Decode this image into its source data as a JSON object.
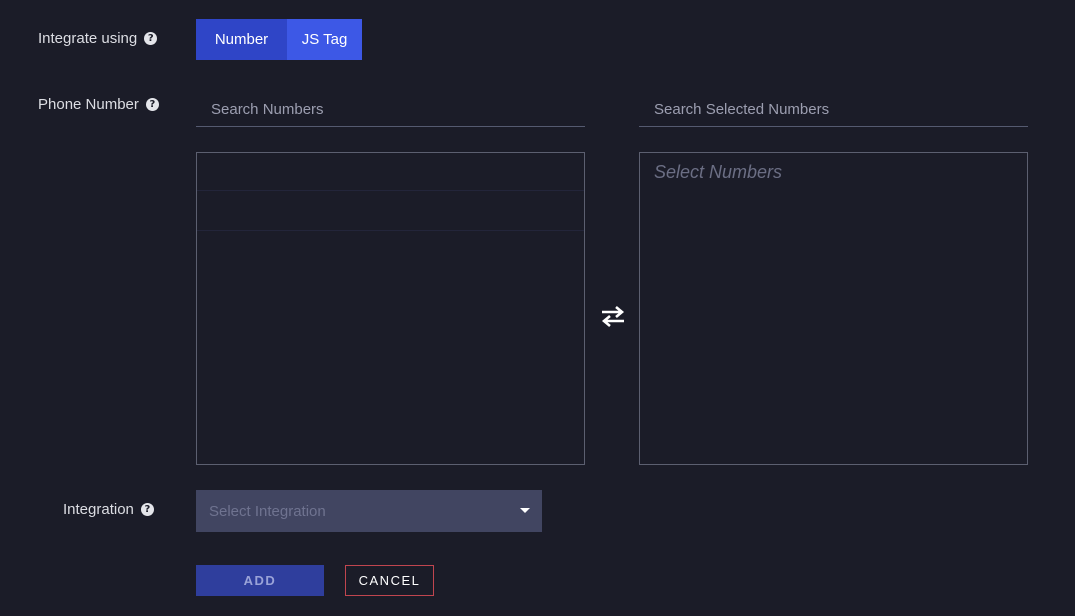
{
  "integrate_using": {
    "label": "Integrate using",
    "help_icon": "?",
    "options": [
      "Number",
      "JS Tag"
    ],
    "selected": "JS Tag"
  },
  "phone_number": {
    "label": "Phone Number",
    "help_icon": "?",
    "search_available_placeholder": "Search Numbers",
    "search_selected_placeholder": "Search Selected Numbers",
    "selected_list_placeholder": "Select Numbers",
    "swap_icon": "swap-arrows-icon"
  },
  "integration": {
    "label": "Integration",
    "help_icon": "?",
    "select_placeholder": "Select Integration"
  },
  "actions": {
    "add_label": "ADD",
    "cancel_label": "CANCEL"
  },
  "colors": {
    "background": "#1b1c28",
    "toggle_number": "#2f45c7",
    "toggle_jstag": "#3d58e6",
    "add_button": "#2f3e9d",
    "cancel_border": "#c0454f"
  }
}
